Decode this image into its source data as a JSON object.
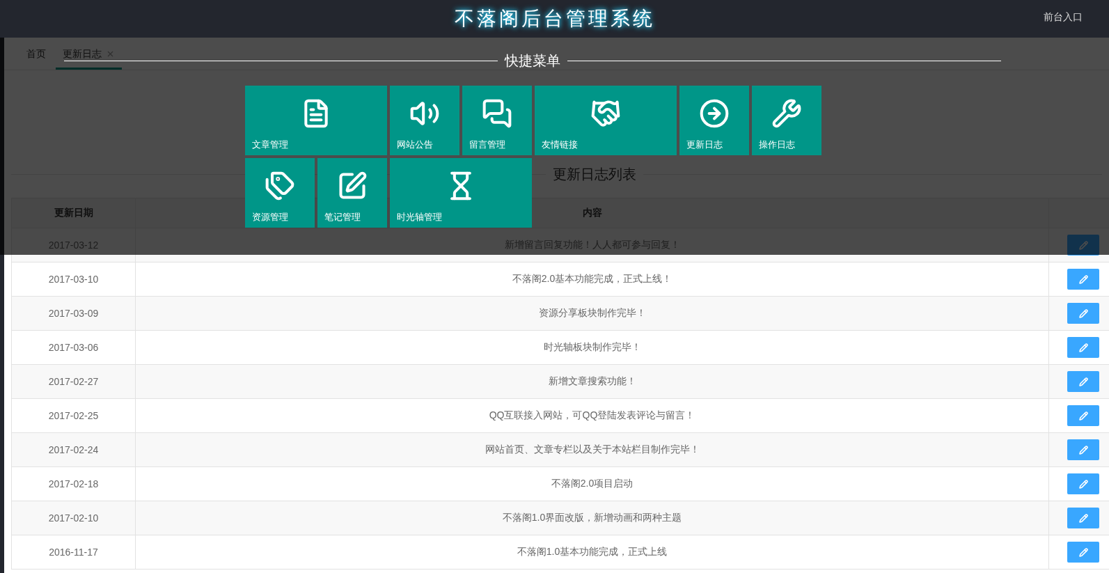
{
  "header": {
    "title": "不落阁后台管理系统",
    "link": "前台入口"
  },
  "tabs": [
    {
      "label": "首页",
      "selected": false,
      "closable": false
    },
    {
      "label": "更新日志",
      "selected": true,
      "closable": true
    }
  ],
  "section_title": "更新日志列表",
  "table": {
    "columns": [
      "更新日期",
      "内容"
    ],
    "rows": [
      {
        "date": "2017-03-12",
        "content": "新增留言回复功能！人人都可参与回复！"
      },
      {
        "date": "2017-03-10",
        "content": "不落阁2.0基本功能完成，正式上线！"
      },
      {
        "date": "2017-03-09",
        "content": "资源分享板块制作完毕！"
      },
      {
        "date": "2017-03-06",
        "content": "时光轴板块制作完毕！"
      },
      {
        "date": "2017-02-27",
        "content": "新增文章搜索功能！"
      },
      {
        "date": "2017-02-25",
        "content": "QQ互联接入网站，可QQ登陆发表评论与留言！"
      },
      {
        "date": "2017-02-24",
        "content": "网站首页、文章专栏以及关于本站栏目制作完毕！"
      },
      {
        "date": "2017-02-18",
        "content": "不落阁2.0项目启动"
      },
      {
        "date": "2017-02-10",
        "content": "不落阁1.0界面改版，新增动画和两种主题"
      },
      {
        "date": "2016-11-17",
        "content": "不落阁1.0基本功能完成，正式上线"
      }
    ]
  },
  "quick_menu": {
    "title": "快捷菜单",
    "tiles": [
      {
        "label": "文章管理",
        "kind": "document",
        "wide": true
      },
      {
        "label": "网站公告",
        "kind": "speaker",
        "wide": false
      },
      {
        "label": "留言管理",
        "kind": "chat",
        "wide": false
      },
      {
        "label": "友情链接",
        "kind": "handshake",
        "wide": true
      },
      {
        "label": "更新日志",
        "kind": "arrow",
        "wide": false
      },
      {
        "label": "操作日志",
        "kind": "wrench",
        "wide": false
      },
      {
        "label": "资源管理",
        "kind": "tags",
        "wide": false
      },
      {
        "label": "笔记管理",
        "kind": "edit",
        "wide": false
      },
      {
        "label": "时光轴管理",
        "kind": "hourglass",
        "wide": true
      }
    ]
  }
}
